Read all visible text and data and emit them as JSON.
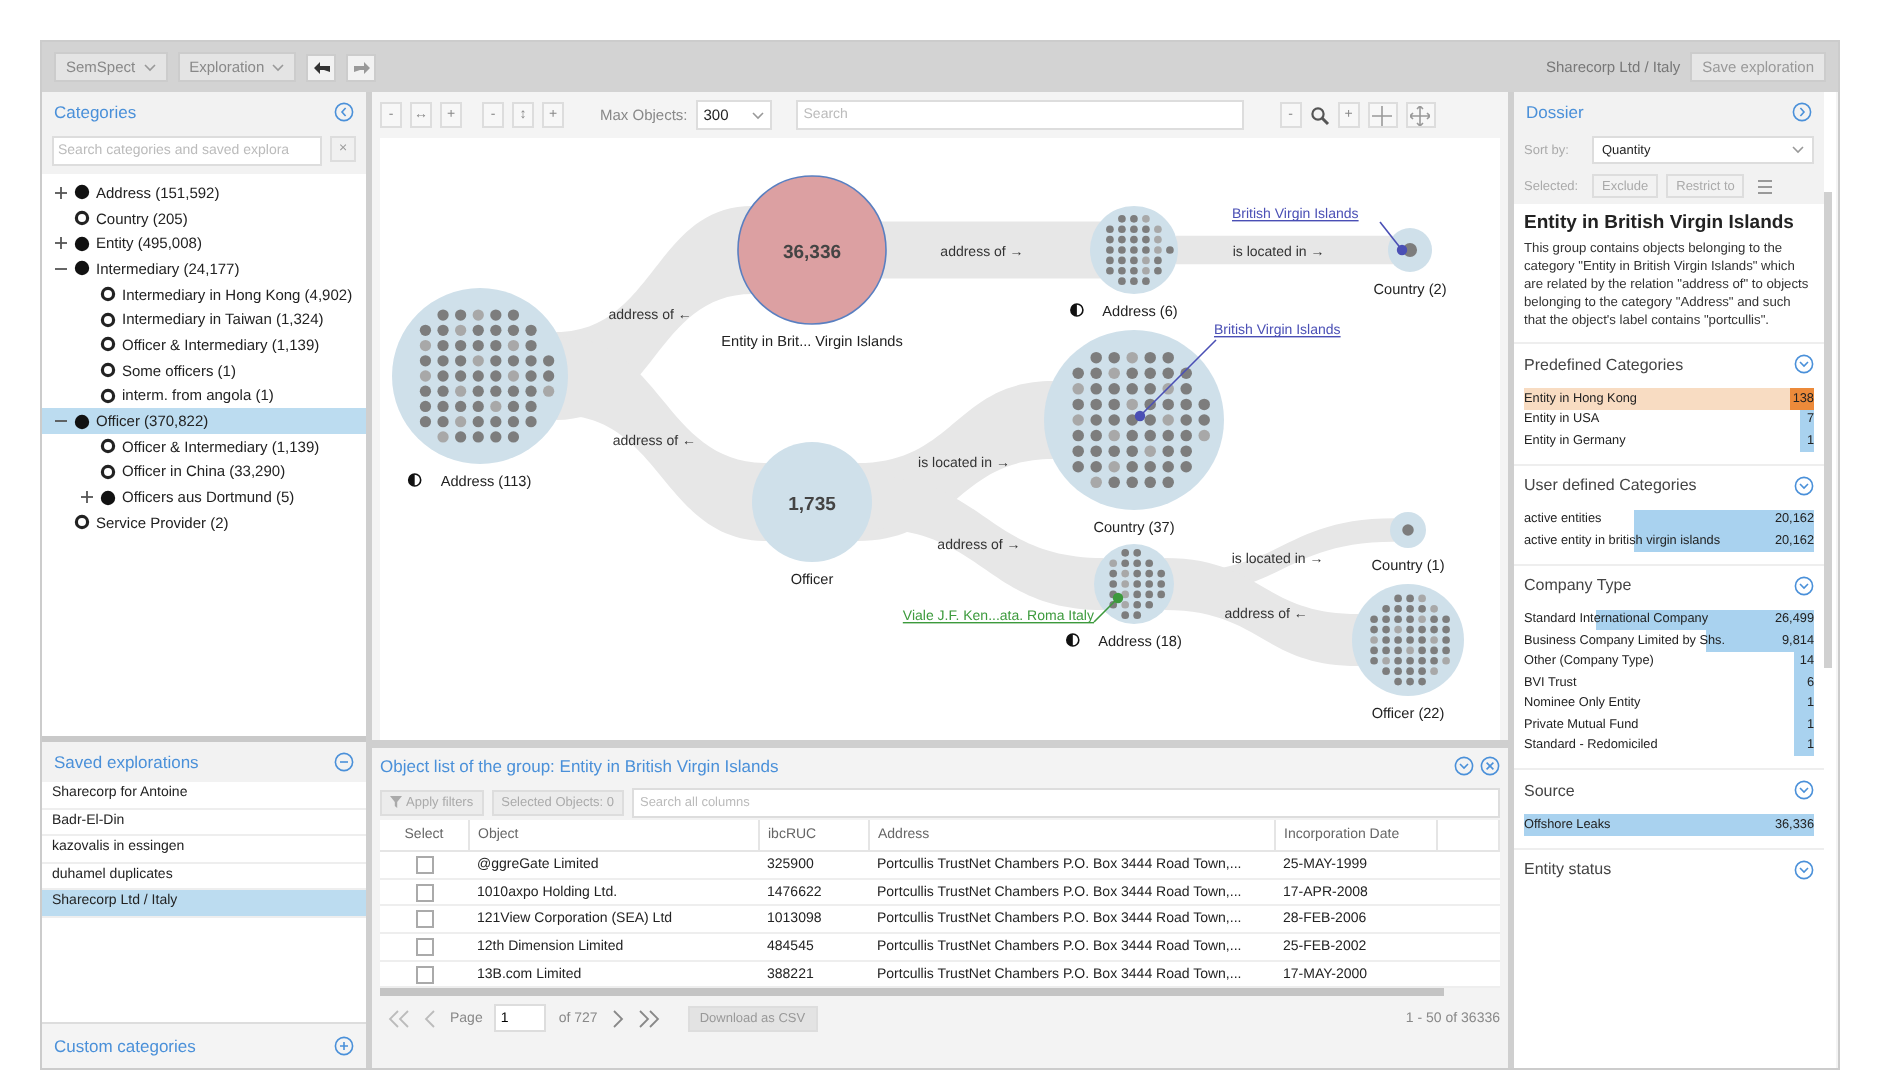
{
  "top_bar": {
    "menus": [
      "SemSpect",
      "Exploration"
    ],
    "exploration_name": "Sharecorp Ltd / Italy",
    "save_button": "Save exploration"
  },
  "categories": {
    "title": "Categories",
    "search": {
      "placeholder": "Search categories and saved explora"
    },
    "clear_button": "×",
    "tree": [
      {
        "label": "Address (151,592)",
        "expanded": false,
        "selected": false
      },
      {
        "label": "Country (205)",
        "selected": false
      },
      {
        "label": "Entity (495,008)",
        "expanded": false,
        "selected": false
      },
      {
        "label": "Intermediary (24,177)",
        "expanded": true,
        "selected": false,
        "children": [
          {
            "label": "Intermediary in Hong Kong (4,902)",
            "selected": false
          },
          {
            "label": "Intermediary in Taiwan (1,324)",
            "selected": false
          },
          {
            "label": "Officer & Intermediary (1,139)",
            "selected": false
          },
          {
            "label": "Some officers (1)",
            "selected": false
          },
          {
            "label": "interm. from angola (1)",
            "selected": false
          }
        ]
      },
      {
        "label": "Officer (370,822)",
        "expanded": true,
        "selected": true,
        "children": [
          {
            "label": "Officer & Intermediary (1,139)",
            "selected": false
          },
          {
            "label": "Officer in China (33,290)",
            "selected": false
          },
          {
            "label": "Officers aus Dortmund (5)",
            "expanded": false,
            "selected": false
          }
        ]
      },
      {
        "label": "Service Provider (2)",
        "selected": false
      }
    ]
  },
  "saved_explorations": {
    "title": "Saved explorations",
    "items": [
      {
        "label": "Sharecorp for Antoine",
        "selected": false
      },
      {
        "label": "Badr-El-Din",
        "selected": false
      },
      {
        "label": "kazovalis in essingen",
        "selected": false
      },
      {
        "label": "duhamel duplicates",
        "selected": false
      },
      {
        "label": "Sharecorp Ltd / Italy",
        "selected": true
      }
    ]
  },
  "custom_categories": {
    "title": "Custom categories"
  },
  "graph_toolbar": {
    "left_buttons": [
      "-",
      "↔",
      "+",
      "-",
      "↕",
      "+"
    ],
    "max_objects_label": "Max Objects:",
    "max_objects": "300",
    "search": {
      "placeholder": "Search"
    },
    "zoom_buttons": [
      "-",
      "+"
    ]
  },
  "graph": {
    "nodes": [
      {
        "label": "Address (113)",
        "partial": true,
        "color": "#cfe0ea"
      },
      {
        "label": "Entity in Brit... Virgin Islands",
        "count": "36,336",
        "color": "#dca0a2"
      },
      {
        "label": "Address (6)",
        "partial": true,
        "color": "#cfe0ea"
      },
      {
        "label": "Country (2)",
        "color": "#cfe0ea",
        "callout": {
          "text": "British Virgin Islands",
          "color": "#4a4fb5"
        }
      },
      {
        "label": "Country (37)",
        "color": "#cfe0ea",
        "callout": {
          "text": "British Virgin Islands",
          "color": "#4a4fb5"
        }
      },
      {
        "label": "Officer",
        "count": "1,735",
        "color": "#cfe0ea"
      },
      {
        "label": "Country (1)",
        "color": "#cfe0ea"
      },
      {
        "label": "Address (18)",
        "partial": true,
        "color": "#cfe0ea",
        "callout": {
          "text": "Viale J.F. Ken...ata. Roma Italy",
          "color": "#3c9a3c"
        }
      },
      {
        "label": "Officer (22)",
        "color": "#cfe0ea"
      }
    ],
    "edges": [
      {
        "label": "address of ←"
      },
      {
        "label": "address of ←"
      },
      {
        "label": "address of →"
      },
      {
        "label": "is located in →"
      },
      {
        "label": "is located in →"
      },
      {
        "label": "address of →"
      },
      {
        "label": "is located in →"
      },
      {
        "label": "address of ←"
      }
    ]
  },
  "object_list": {
    "title": "Object list of the group: Entity in British Virgin Islands",
    "apply_filters": "Apply filters",
    "selected_objects": "Selected Objects: 0",
    "search": {
      "placeholder": "Search all columns"
    },
    "columns": [
      "Select",
      "Object",
      "ibcRUC",
      "Address",
      "Incorporation Date"
    ],
    "rows": [
      {
        "checked": false,
        "cells": [
          "",
          "@ggreGate Limited",
          "325900",
          "Portcullis TrustNet Chambers P.O. Box 3444 Road Town,...",
          "25-MAY-1999"
        ]
      },
      {
        "checked": false,
        "cells": [
          "",
          "1010axpo Holding Ltd.",
          "1476622",
          "Portcullis TrustNet Chambers P.O. Box 3444 Road Town,...",
          "17-APR-2008"
        ]
      },
      {
        "checked": false,
        "cells": [
          "",
          "121View Corporation (SEA) Ltd",
          "1013098",
          "Portcullis TrustNet Chambers P.O. Box 3444 Road Town,...",
          "28-FEB-2006"
        ]
      },
      {
        "checked": false,
        "cells": [
          "",
          "12th Dimension Limited",
          "484545",
          "Portcullis TrustNet Chambers P.O. Box 3444 Road Town,...",
          "25-FEB-2002"
        ]
      },
      {
        "checked": false,
        "cells": [
          "",
          "13B.com Limited",
          "388221",
          "Portcullis TrustNet Chambers P.O. Box 3444 Road Town,...",
          "17-MAY-2000"
        ]
      }
    ],
    "pager": {
      "page_label": "Page",
      "page": "1",
      "of": "of 727",
      "download": "Download as CSV",
      "range": "1 - 50 of 36336"
    }
  },
  "dossier": {
    "title": "Dossier",
    "sort_label": "Sort by:",
    "sort_value": "Quantity",
    "selected_label": "Selected:",
    "actions": [
      "Exclude",
      "Restrict to"
    ],
    "heading": "Entity in British Virgin Islands",
    "description": "This group contains objects belonging to the category \"Entity in British Virgin Islands\" which are related by the relation \"address of\" to objects belonging to the category \"Address\" and such that the object's label contains \"portcullis\".",
    "sections": [
      {
        "title": "Predefined Categories",
        "items": [
          {
            "label": "Entity in Hong Kong",
            "value": "138",
            "level": 0.08,
            "selected": true
          },
          {
            "label": "Entity in USA",
            "value": "7",
            "level": 0.05,
            "selected": false
          },
          {
            "label": "Entity in Germany",
            "value": "1",
            "level": 0.05,
            "selected": false
          }
        ]
      },
      {
        "title": "User defined Categories",
        "items": [
          {
            "label": "active entities",
            "value": "20,162",
            "level": 0.62,
            "selected": false
          },
          {
            "label": "active entity in british virgin islands",
            "value": "20,162",
            "level": 0.62,
            "selected": false
          }
        ]
      },
      {
        "title": "Company Type",
        "items": [
          {
            "label": "Standard International Company",
            "value": "26,499",
            "level": 0.75,
            "selected": false
          },
          {
            "label": "Business Company Limited by Shs.",
            "value": "9,814",
            "level": 0.37,
            "selected": false
          },
          {
            "label": "Other (Company Type)",
            "value": "14",
            "level": 0.07,
            "selected": false
          },
          {
            "label": "BVI Trust",
            "value": "6",
            "level": 0.07,
            "selected": false
          },
          {
            "label": "Nominee Only Entity",
            "value": "1",
            "level": 0.07,
            "selected": false
          },
          {
            "label": "Private Mutual Fund",
            "value": "1",
            "level": 0.07,
            "selected": false
          },
          {
            "label": "Standard - Redomiciled",
            "value": "1",
            "level": 0.07,
            "selected": false
          }
        ]
      },
      {
        "title": "Source",
        "items": [
          {
            "label": "Offshore Leaks",
            "value": "36,336",
            "level": 1,
            "selected": false
          }
        ]
      },
      {
        "title": "Entity status"
      }
    ]
  }
}
